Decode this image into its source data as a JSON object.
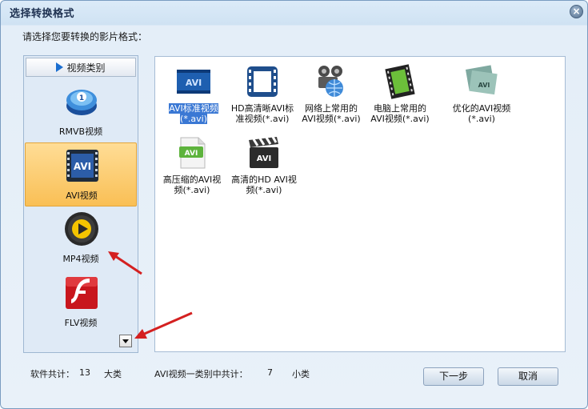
{
  "window": {
    "title": "选择转换格式",
    "close_glyph": "×"
  },
  "prompt": "请选择您要转换的影片格式：",
  "categories": {
    "header": "视频类别",
    "items": [
      {
        "label": "RMVB视频",
        "icon": "rmvb-icon",
        "selected": false
      },
      {
        "label": "AVI视频",
        "icon": "avi-film-icon",
        "selected": true
      },
      {
        "label": "MP4视频",
        "icon": "mp4-play-icon",
        "selected": false
      },
      {
        "label": "FLV视频",
        "icon": "flash-icon",
        "selected": false
      }
    ]
  },
  "formats": [
    {
      "line1": "AVI标准视频",
      "line2": "(*.avi)",
      "icon": "avi-standard-icon",
      "selected": true
    },
    {
      "line1": "HD高清晰AVI标",
      "line2": "准视频(*.avi)",
      "icon": "hd-film-icon",
      "selected": false
    },
    {
      "line1": "网络上常用的",
      "line2": "AVI视频(*.avi)",
      "icon": "network-globe-icon",
      "selected": false
    },
    {
      "line1": "电脑上常用的",
      "line2": "AVI视频(*.avi)",
      "icon": "computer-film-icon",
      "selected": false
    },
    {
      "line1": "优化的AVI视频",
      "line2": "(*.avi)",
      "icon": "optimized-avi-icon",
      "selected": false
    },
    {
      "line1": "高压缩的AVI视",
      "line2": "频(*.avi)",
      "icon": "compressed-avi-icon",
      "selected": false
    },
    {
      "line1": "高清的HD AVI视",
      "line2": "频(*.avi)",
      "icon": "clapperboard-icon",
      "selected": false
    }
  ],
  "status": {
    "software_label": "软件共计：",
    "software_count": "13",
    "software_unit": "大类",
    "category_label": "AVI视频一类别中共计：",
    "category_count": "7",
    "category_unit": "小类"
  },
  "buttons": {
    "next": "下一步",
    "cancel": "取消"
  },
  "colors": {
    "selection": "#3a78d4",
    "selected_category": "#f9bf55",
    "annotation_arrow": "#d42020"
  }
}
